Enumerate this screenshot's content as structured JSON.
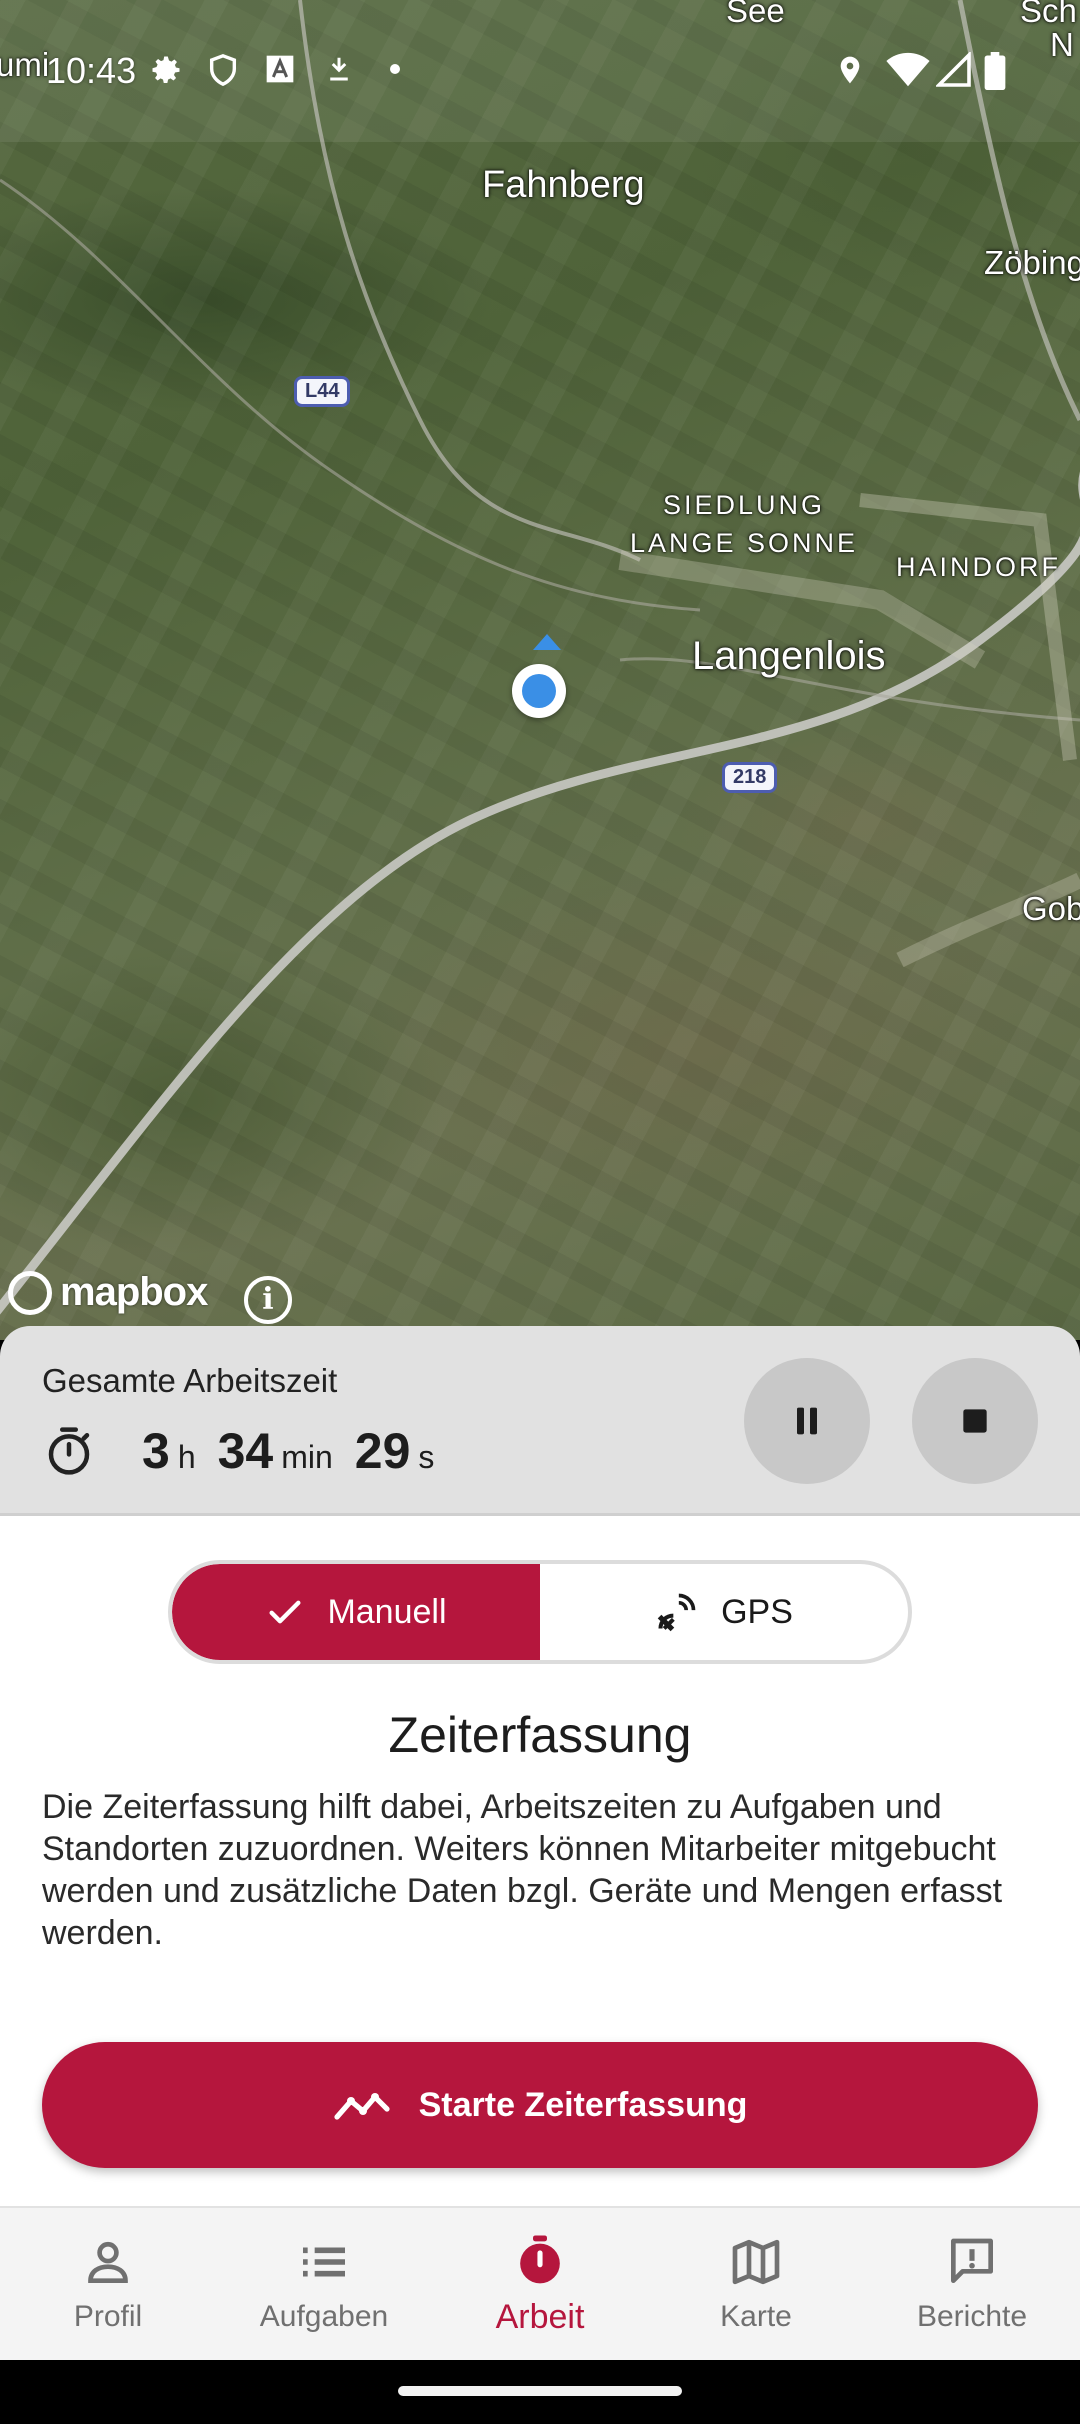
{
  "status_bar": {
    "time": "10:43",
    "icons": [
      "settings-icon",
      "shield-icon",
      "text-a-icon",
      "download-icon",
      "dot-icon",
      "location-pin-icon",
      "wifi-icon",
      "signal-icon",
      "battery-icon"
    ]
  },
  "map": {
    "places": {
      "see": "See",
      "sch": "Sch",
      "n": "N",
      "umi": "umi",
      "fahnberg": "Fahnberg",
      "zobing": "Zöbing",
      "siedlung": "SIEDLUNG\nLANGE SONNE",
      "haindorf": "HAINDORF",
      "langenlois": "Langenlois",
      "gob": "Gob"
    },
    "road_labels": {
      "l44": "L44",
      "r218": "218"
    },
    "attribution": "mapbox",
    "info_label": "i"
  },
  "timer": {
    "title": "Gesamte Arbeitszeit",
    "hours": "3",
    "hours_unit": "h",
    "minutes": "34",
    "minutes_unit": "min",
    "seconds": "29",
    "seconds_unit": "s"
  },
  "mode_toggle": {
    "manual_label": "Manuell",
    "gps_label": "GPS",
    "selected": "Manuell"
  },
  "section": {
    "title": "Zeiterfassung",
    "description": "Die Zeiterfassung hilft dabei, Arbeitszeiten zu Aufgaben und Standorten zuzuordnen. Weiters können Mitarbeiter mitgebucht werden und zusätzliche Daten bzgl. Geräte und Mengen erfasst werden."
  },
  "start_button": {
    "label": "Starte Zeiterfassung"
  },
  "bottom_nav": [
    {
      "label": "Profil",
      "icon": "person-icon",
      "active": false
    },
    {
      "label": "Aufgaben",
      "icon": "list-icon",
      "active": false
    },
    {
      "label": "Arbeit",
      "icon": "timer-icon",
      "active": true
    },
    {
      "label": "Karte",
      "icon": "map-icon",
      "active": false
    },
    {
      "label": "Berichte",
      "icon": "report-icon",
      "active": false
    }
  ],
  "colors": {
    "accent": "#b5163d",
    "panel": "#e1e1e1",
    "location": "#3a8fe6"
  }
}
